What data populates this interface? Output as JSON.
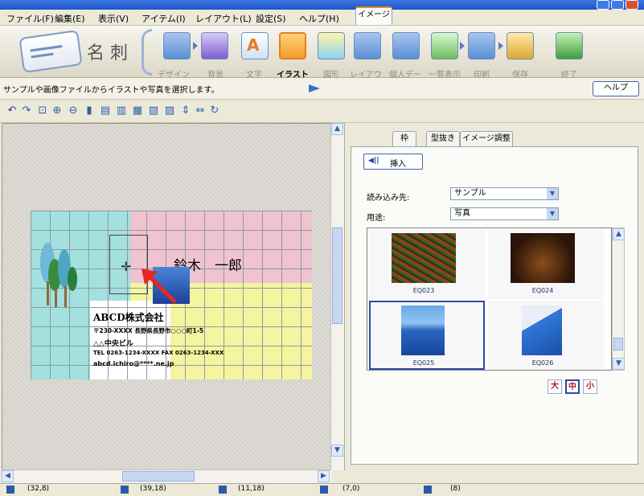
{
  "menu": [
    "ファイル(F)",
    "編集(E)",
    "表示(V)",
    "アイテム(I)",
    "レイアウト(L)",
    "設定(S)",
    "ヘルプ(H)"
  ],
  "app": {
    "mode_label": "名 刺"
  },
  "steps": [
    {
      "label": "デザイン選択",
      "icon": "design-icon",
      "active": false
    },
    {
      "label": "背景",
      "icon": "background-icon",
      "active": false
    },
    {
      "label": "文字",
      "icon": "text-icon",
      "active": false
    },
    {
      "label": "イラスト",
      "icon": "illustration-icon",
      "active": true
    },
    {
      "label": "図形",
      "icon": "shape-icon",
      "active": false
    },
    {
      "label": "レイアウト",
      "icon": "layout-icon",
      "active": false
    },
    {
      "label": "個人データ",
      "icon": "personal-data-icon",
      "active": false
    },
    {
      "label": "一覧表示",
      "icon": "list-view-icon",
      "active": false
    },
    {
      "label": "印刷",
      "icon": "print-icon",
      "active": false
    },
    {
      "label": "保存",
      "icon": "save-icon",
      "active": false
    },
    {
      "label": "終了",
      "icon": "exit-icon",
      "active": false
    }
  ],
  "hint": {
    "text": "サンプルや画像ファイルからイラストや写真を選択します。",
    "help_label": "ヘルプ"
  },
  "card": {
    "name": "鈴木　一郎",
    "company": "ABCD株式会社",
    "address1": "〒230-XXXX 長野県長野市○○○町1-5",
    "address2": "△△中央ビル",
    "phone": "TEL 0263-1234-XXXX FAX 0263-1234-XXX",
    "email": "abcd.ichiro@****.ne.jp"
  },
  "panel": {
    "tabs": [
      "イメージ",
      "枠",
      "型抜き",
      "イメージ調整"
    ],
    "insert_label": "挿入",
    "source_label": "読み込み先:",
    "source_value": "サンプル",
    "purpose_label": "用途:",
    "purpose_value": "写真",
    "thumbnails": [
      "EQ023",
      "EQ024",
      "EQ025",
      "EQ026"
    ],
    "size_buttons": [
      "大",
      "中",
      "小"
    ]
  },
  "status": [
    "(32,8)",
    "(39,18)",
    "(11,18)",
    "(7,0)",
    "(8)"
  ],
  "colors": {
    "card_cyan": "#a3e0de",
    "card_pink": "#efc3d0",
    "card_yellow": "#f4f59e",
    "accent_blue": "#2e4b9f"
  }
}
